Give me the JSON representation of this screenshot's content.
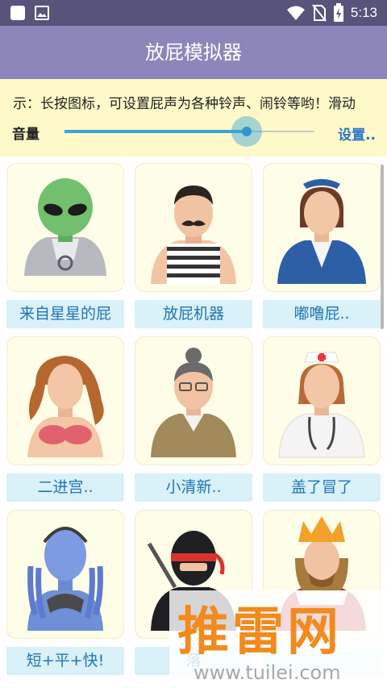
{
  "status_bar": {
    "time": "5:13",
    "left_icons": [
      "notification-square-icon",
      "image-icon"
    ],
    "right_icons": [
      "wifi-icon",
      "no-sim-icon",
      "battery-charging-icon"
    ]
  },
  "header": {
    "title": "放屁模拟器"
  },
  "notice": {
    "text": "示：长按图标，可设置屁声为各种铃声、闹铃等哟！滑动"
  },
  "volume": {
    "label": "音量",
    "level_percent": 73,
    "settings_label": "设置.."
  },
  "items": [
    {
      "label": "来自星星的屁",
      "icon": "alien-avatar"
    },
    {
      "label": "放屁机器",
      "icon": "mustache-man-avatar"
    },
    {
      "label": "嘟噜屁..",
      "icon": "flight-attendant-avatar"
    },
    {
      "label": "二进宫..",
      "icon": "mermaid-avatar"
    },
    {
      "label": "小清新..",
      "icon": "old-lady-avatar"
    },
    {
      "label": "盖了冒了",
      "icon": "nurse-avatar"
    },
    {
      "label": "短+平+快!",
      "icon": "alien-woman-avatar"
    },
    {
      "label": "落",
      "icon": "ninja-avatar"
    },
    {
      "label": "",
      "icon": "king-avatar"
    }
  ],
  "watermark": {
    "brand": "推雷网",
    "url": "www.tuilei.com"
  },
  "colors": {
    "status_bar": "#57537a",
    "title_bar": "#8d86ba",
    "panel": "#fdf9c9",
    "label_bg": "#d9f1f8",
    "label_text": "#2175b7",
    "accent": "#3aa5d9"
  }
}
